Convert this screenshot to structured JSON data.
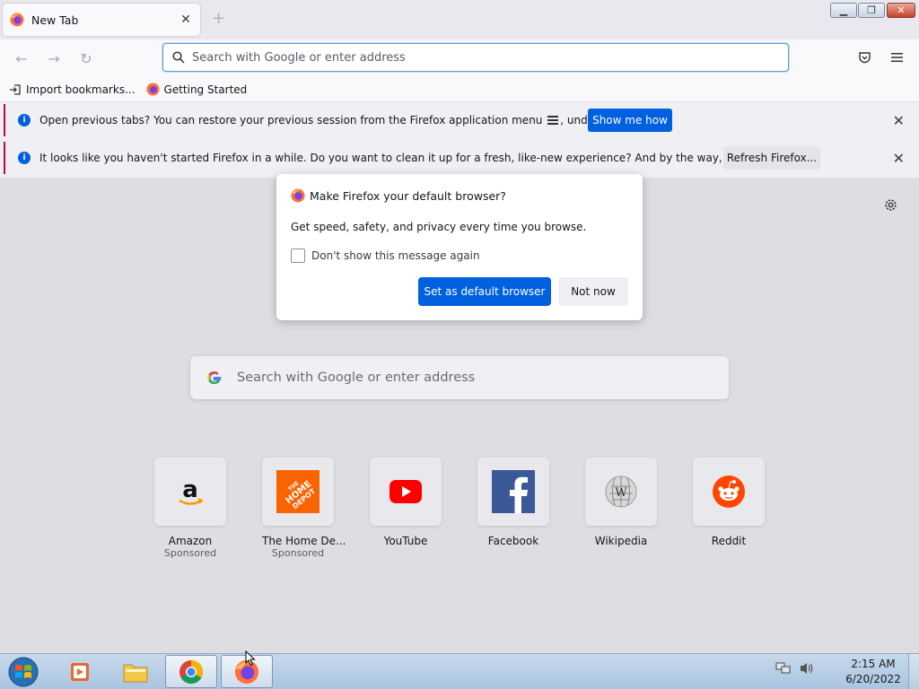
{
  "window": {
    "tab_title": "New Tab"
  },
  "navbar": {
    "url_placeholder": "Search with Google or enter address"
  },
  "bookmarks": [
    {
      "label": "Import bookmarks..."
    },
    {
      "label": "Getting Started"
    }
  ],
  "notifications": [
    {
      "message_before": "Open previous tabs? You can restore your previous session from the Firefox application menu",
      "message_after": ", under History.",
      "button": "Show me how"
    },
    {
      "message": "It looks like you haven't started Firefox in a while. Do you want to clean it up for a fresh, like-new experience? And by the way, welcome back!",
      "button": "Refresh Firefox..."
    }
  ],
  "dialog": {
    "title": "Make Firefox your default browser?",
    "body": "Get speed, safety, and privacy every time you browse.",
    "checkbox_label": "Don't show this message again",
    "primary_button": "Set as default browser",
    "secondary_button": "Not now"
  },
  "content": {
    "search_placeholder": "Search with Google or enter address",
    "top_sites": [
      {
        "title": "Amazon",
        "sub": "Sponsored",
        "icon": "amazon-icon"
      },
      {
        "title": "The Home De...",
        "sub": "Sponsored",
        "icon": "home-depot-icon"
      },
      {
        "title": "YouTube",
        "sub": "",
        "icon": "youtube-icon"
      },
      {
        "title": "Facebook",
        "sub": "",
        "icon": "facebook-icon"
      },
      {
        "title": "Wikipedia",
        "sub": "",
        "icon": "wikipedia-icon"
      },
      {
        "title": "Reddit",
        "sub": "",
        "icon": "reddit-icon"
      }
    ]
  },
  "taskbar": {
    "time": "2:15 AM",
    "date": "6/20/2022"
  },
  "colors": {
    "accent": "#0061e0",
    "notification_stripe": "#c40054"
  }
}
